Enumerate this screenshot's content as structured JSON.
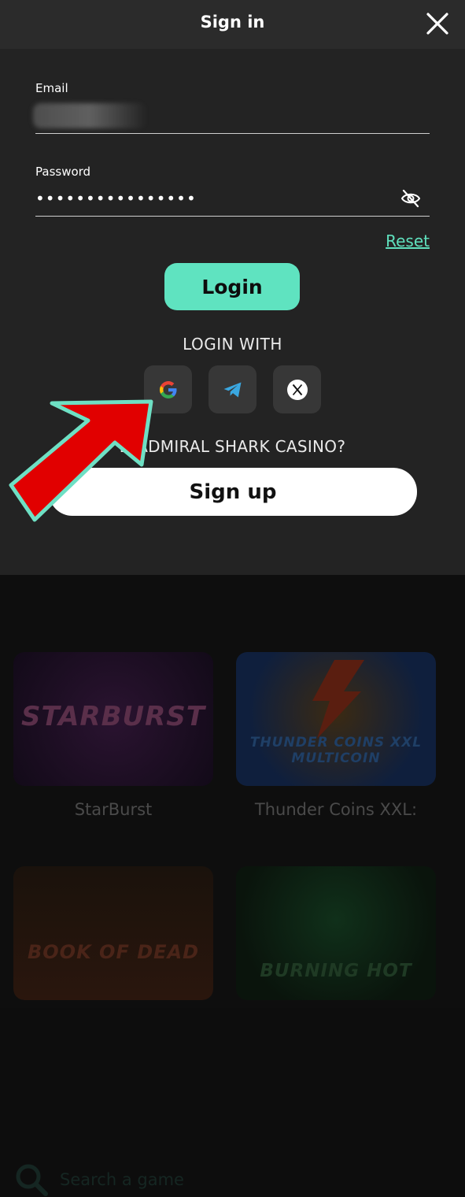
{
  "header": {
    "title": "Sign in"
  },
  "form": {
    "email_label": "Email",
    "password_label": "Password",
    "password_value": "••••••••••••••••",
    "reset_label": "Reset",
    "login_label": "Login",
    "login_with_label": "LOGIN WITH",
    "social": [
      {
        "name": "google-icon"
      },
      {
        "name": "telegram-icon"
      },
      {
        "name": "x-icon"
      }
    ],
    "new_text": "D ADMIRAL SHARK CASINO?",
    "signup_label": "Sign up"
  },
  "background": {
    "search_placeholder": "Search a game",
    "games": [
      {
        "title": "StarBurst",
        "logo": "STARBURST"
      },
      {
        "title": "Thunder Coins XXL:",
        "logo": "THUNDER COINS XXL MULTICOIN"
      },
      {
        "title": "",
        "logo": "BOOK OF DEAD"
      },
      {
        "title": "",
        "logo": "BURNING HOT"
      }
    ]
  },
  "colors": {
    "accent": "#5fe3c0",
    "modal_bg": "#232323",
    "arrow": "#e10000"
  }
}
